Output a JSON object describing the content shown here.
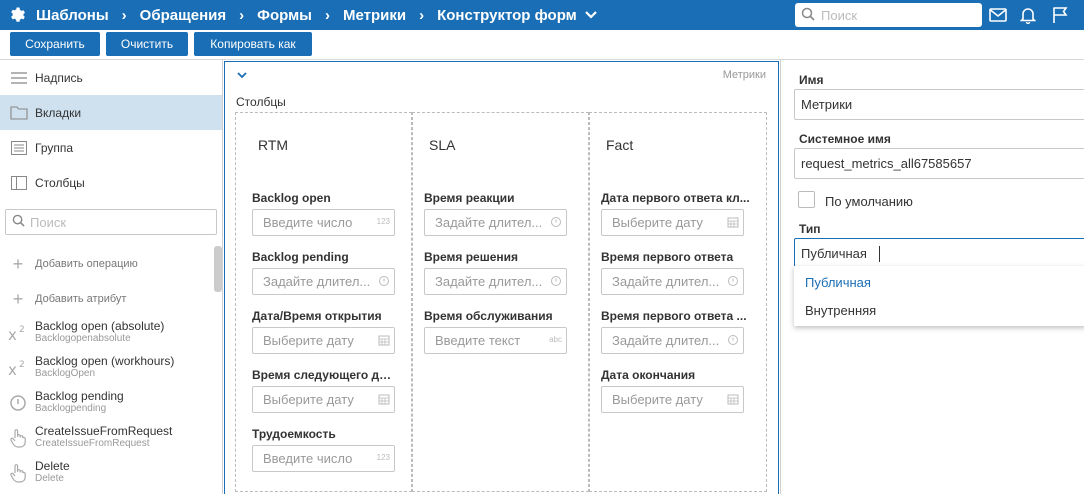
{
  "nav": {
    "breadcrumbs": [
      "Шаблоны",
      "Обращения",
      "Формы",
      "Метрики",
      "Конструктор форм"
    ],
    "search_placeholder": "Поиск"
  },
  "toolbar": {
    "save_label": "Сохранить",
    "clear_label": "Очистить",
    "copy_label": "Копировать как"
  },
  "sidebar": {
    "elements": [
      {
        "label": "Надпись",
        "icon": "lines-icon"
      },
      {
        "label": "Вкладки",
        "icon": "folder-icon",
        "active": true
      },
      {
        "label": "Группа",
        "icon": "group-icon"
      },
      {
        "label": "Столбцы",
        "icon": "columns-icon"
      }
    ],
    "search_placeholder": "Поиск",
    "operations": [
      {
        "label": "Добавить операцию"
      },
      {
        "label": "Добавить атрибут"
      }
    ],
    "attributes": [
      {
        "title": "Backlog open (absolute)",
        "sub": "Backlogopenabsolute",
        "icon": "superscript-icon"
      },
      {
        "title": "Backlog open (workhours)",
        "sub": "BacklogOpen",
        "icon": "superscript-icon"
      },
      {
        "title": "Backlog pending",
        "sub": "Backlogpending",
        "icon": "timer-icon"
      },
      {
        "title": "CreateIssueFromRequest",
        "sub": "CreateIssueFromRequest",
        "icon": "hand-pointer-icon"
      },
      {
        "title": "Delete",
        "sub": "Delete",
        "icon": "hand-pointer-icon"
      }
    ]
  },
  "canvas": {
    "tag": "Метрики",
    "columns_title": "Столбцы",
    "columns": [
      {
        "title": "RTM",
        "fields": [
          {
            "label": "Backlog open",
            "placeholder": "Введите число",
            "suffix": "123"
          },
          {
            "label": "Backlog pending",
            "placeholder": "Задайте длител...",
            "suffix_icon": "timer"
          },
          {
            "label": "Дата/Время открытия",
            "placeholder": "Выберите дату",
            "suffix_icon": "calendar"
          },
          {
            "label": "Время следующего де...",
            "placeholder": "Выберите дату",
            "suffix_icon": "calendar"
          },
          {
            "label": "Трудоемкость",
            "placeholder": "Введите число",
            "suffix": "123"
          }
        ]
      },
      {
        "title": "SLA",
        "fields": [
          {
            "label": "Время реакции",
            "placeholder": "Задайте длител...",
            "suffix_icon": "timer"
          },
          {
            "label": "Время решения",
            "placeholder": "Задайте длител...",
            "suffix_icon": "timer"
          },
          {
            "label": "Время обслуживания",
            "placeholder": "Введите текст",
            "suffix": "abc"
          }
        ]
      },
      {
        "title": "Fact",
        "fields": [
          {
            "label": "Дата первого ответа кл...",
            "placeholder": "Выберите дату",
            "suffix_icon": "calendar"
          },
          {
            "label": "Время первого ответа",
            "placeholder": "Задайте длител...",
            "suffix_icon": "timer"
          },
          {
            "label": "Время первого ответа ...",
            "placeholder": "Задайте длител...",
            "suffix_icon": "timer"
          },
          {
            "label": "Дата окончания",
            "placeholder": "Выберите дату",
            "suffix_icon": "calendar"
          }
        ]
      }
    ]
  },
  "props": {
    "name_label": "Имя",
    "name_value": "Метрики",
    "sysname_label": "Системное имя",
    "sysname_value": "request_metrics_all67585657",
    "default_label": "По умолчанию",
    "type_label": "Тип",
    "type_value": "Публичная",
    "type_options": [
      "Публичная",
      "Внутренняя"
    ],
    "accent_color": "#1a6eb5"
  }
}
